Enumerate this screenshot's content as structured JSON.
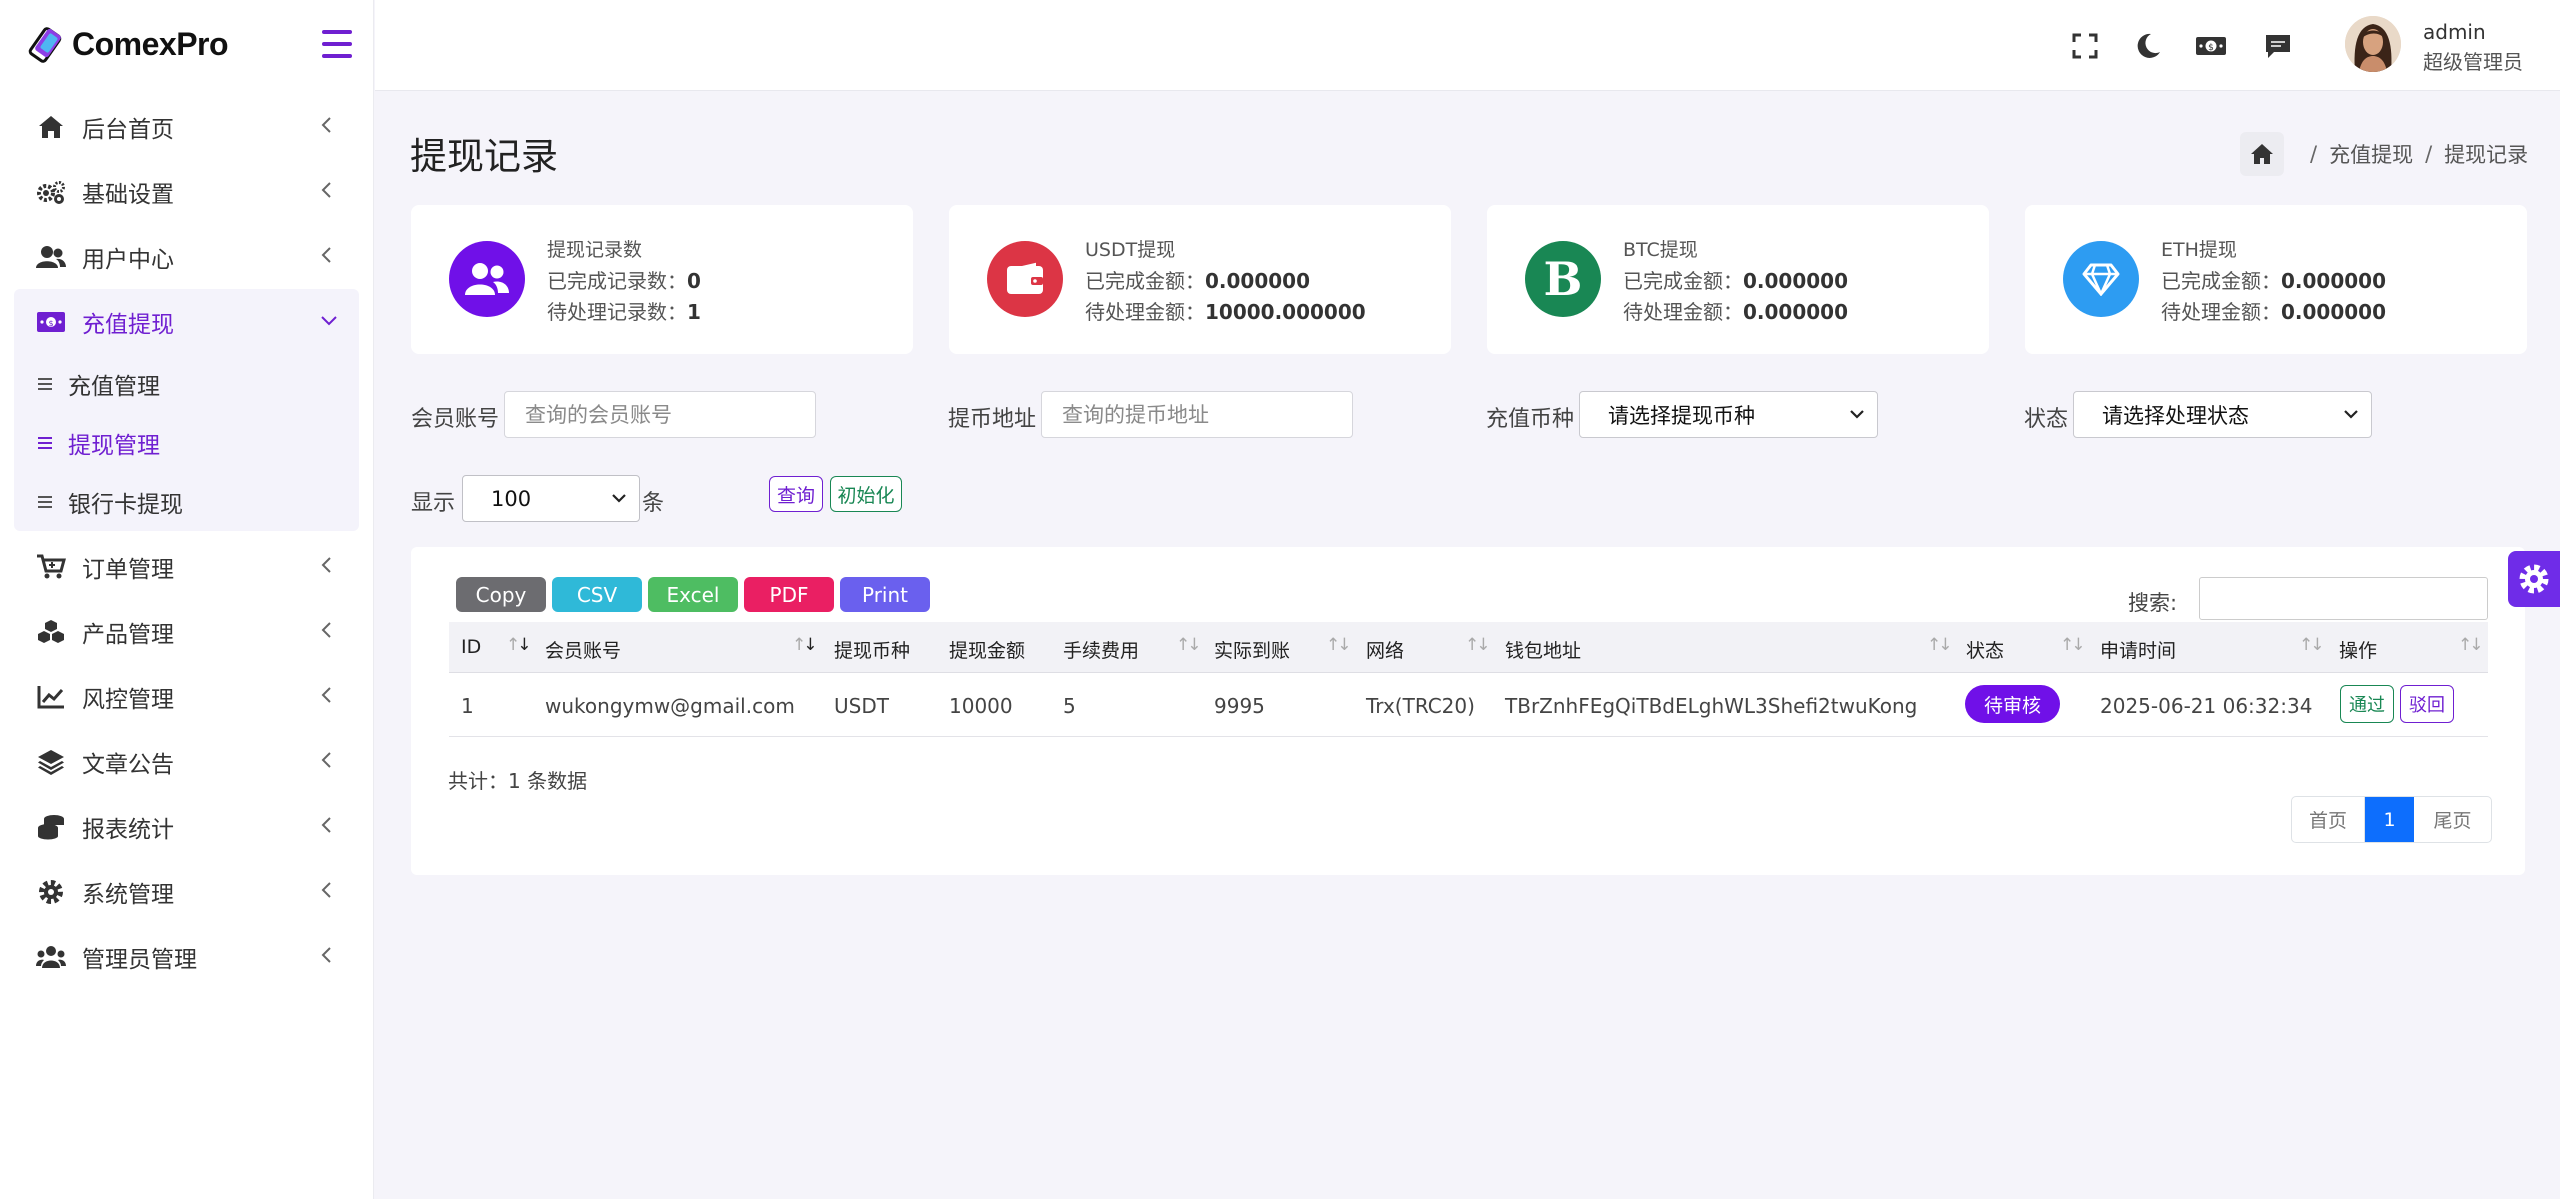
{
  "app": {
    "logo_text": "ComexPro"
  },
  "sidebar": {
    "items": [
      {
        "label": "后台首页",
        "icon": "home-icon"
      },
      {
        "label": "基础设置",
        "icon": "cogs-icon"
      },
      {
        "label": "用户中心",
        "icon": "users-icon"
      },
      {
        "label": "充值提现",
        "icon": "money-icon",
        "active": true,
        "children": [
          {
            "label": "充值管理"
          },
          {
            "label": "提现管理",
            "active": true
          },
          {
            "label": "银行卡提现"
          }
        ]
      },
      {
        "label": "订单管理",
        "icon": "cart-icon"
      },
      {
        "label": "产品管理",
        "icon": "cubes-icon"
      },
      {
        "label": "风控管理",
        "icon": "line-chart-icon"
      },
      {
        "label": "文章公告",
        "icon": "layers-icon"
      },
      {
        "label": "报表统计",
        "icon": "coins-icon"
      },
      {
        "label": "系统管理",
        "icon": "gear-icon"
      },
      {
        "label": "管理员管理",
        "icon": "user-group-icon"
      }
    ]
  },
  "header": {
    "user_name": "admin",
    "user_role": "超级管理员"
  },
  "page": {
    "title": "提现记录",
    "breadcrumb": [
      "充值提现",
      "提现记录"
    ]
  },
  "cards": [
    {
      "title": "提现记录数",
      "row1_label": "已完成记录数：",
      "row1_value": "0",
      "row2_label": "待处理记录数：",
      "row2_value": "1",
      "color": "#7010e8",
      "icon": "users-icon"
    },
    {
      "title": "USDT提现",
      "row1_label": "已完成金额：",
      "row1_value": "0.000000",
      "row2_label": "待处理金额：",
      "row2_value": "10000.000000",
      "color": "#dc3545",
      "icon": "wallet-icon"
    },
    {
      "title": "BTC提现",
      "row1_label": "已完成金额：",
      "row1_value": "0.000000",
      "row2_label": "待处理金额：",
      "row2_value": "0.000000",
      "color": "#198754",
      "icon": "bold-b-icon"
    },
    {
      "title": "ETH提现",
      "row1_label": "已完成金额：",
      "row1_value": "0.000000",
      "row2_label": "待处理金额：",
      "row2_value": "0.000000",
      "color": "#2d9cf2",
      "icon": "diamond-icon"
    }
  ],
  "filters": {
    "member_label": "会员账号",
    "member_placeholder": "查询的会员账号",
    "address_label": "提币地址",
    "address_placeholder": "查询的提币地址",
    "coin_label": "充值币种",
    "coin_selected": "请选择提现币种",
    "status_label": "状态",
    "status_selected": "请选择处理状态",
    "show_label": "显示",
    "show_value": "100",
    "show_unit": "条",
    "query_button": "查询",
    "reset_button": "初始化"
  },
  "export_buttons": [
    {
      "label": "Copy",
      "color": "#6c6c70"
    },
    {
      "label": "CSV",
      "color": "#2fb9d8"
    },
    {
      "label": "Excel",
      "color": "#4ebd62"
    },
    {
      "label": "PDF",
      "color": "#ea1f63"
    },
    {
      "label": "Print",
      "color": "#6a60ee"
    }
  ],
  "search_label": "搜索:",
  "table": {
    "columns": [
      "ID",
      "会员账号",
      "提现币种",
      "提现金额",
      "手续费用",
      "实际到账",
      "网络",
      "钱包地址",
      "状态",
      "申请时间",
      "操作"
    ],
    "rows": [
      {
        "id": "1",
        "account": "wukongymw@gmail.com",
        "coin": "USDT",
        "amount": "10000",
        "fee": "5",
        "actual": "9995",
        "network": "Trx(TRC20)",
        "address": "TBrZnhFEgQiTBdELghWL3Shefi2twuKong",
        "status": "待审核",
        "time": "2025-06-21 06:32:34",
        "approve": "通过",
        "reject": "驳回"
      }
    ]
  },
  "footer": {
    "total": "共计：1 条数据",
    "pager_first": "首页",
    "pager_current": "1",
    "pager_last": "尾页"
  },
  "colors": {
    "accent": "#6f1fd1",
    "primary": "#0d6efd"
  }
}
